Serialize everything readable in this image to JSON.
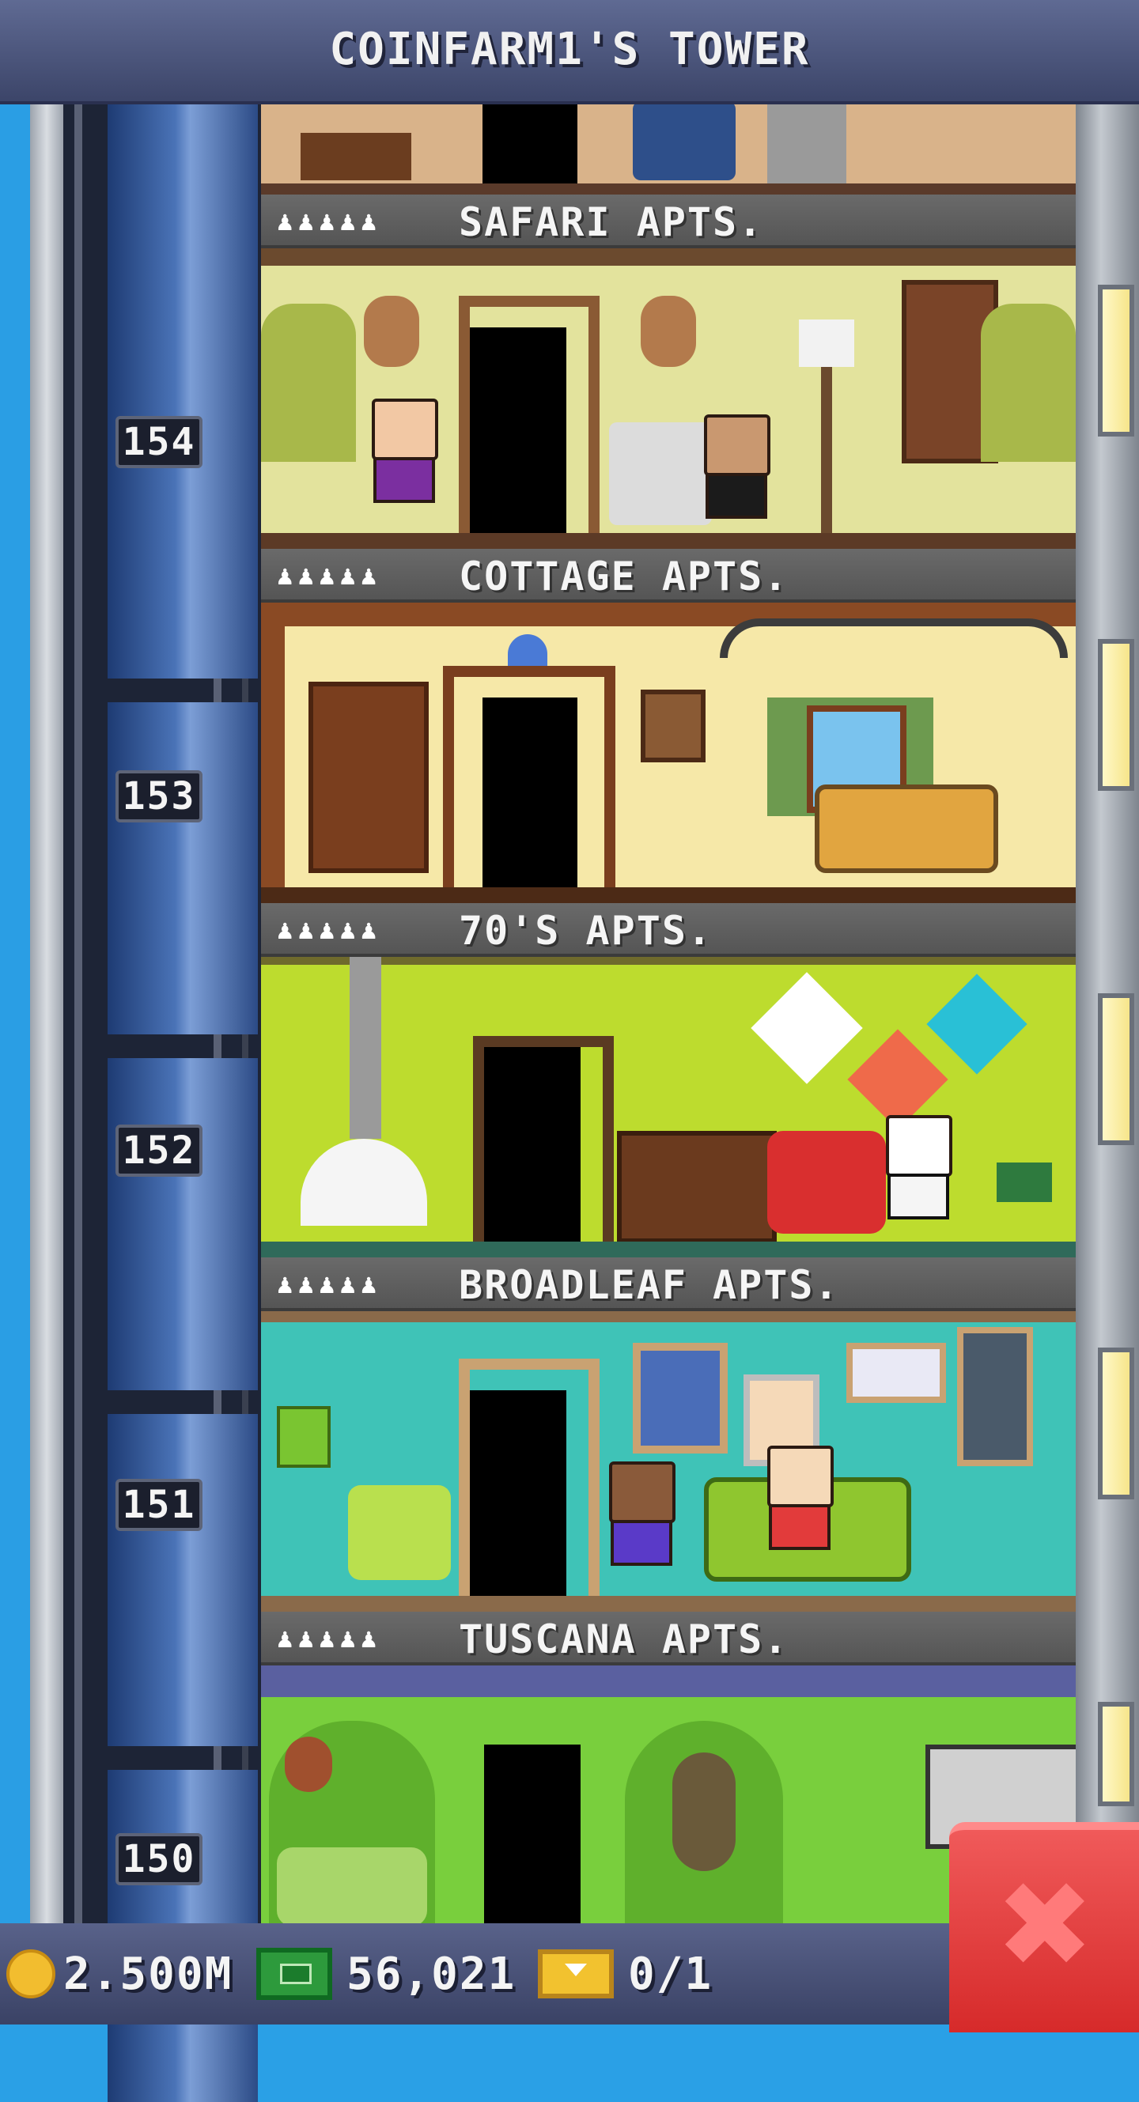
{
  "header": {
    "title": "COINFARM1'S TOWER"
  },
  "floors": [
    {
      "number": "154",
      "name": "SAFARI APTS.",
      "residents_icon": "♟♟♟♟♟"
    },
    {
      "number": "153",
      "name": "COTTAGE APTS.",
      "residents_icon": "♟♟♟♟♟"
    },
    {
      "number": "152",
      "name": "70'S APTS.",
      "residents_icon": "♟♟♟♟♟"
    },
    {
      "number": "151",
      "name": "BROADLEAF APTS.",
      "residents_icon": "♟♟♟♟♟"
    },
    {
      "number": "150",
      "name": "TUSCANA APTS.",
      "residents_icon": "♟♟♟♟♟"
    }
  ],
  "footer": {
    "coins": "2.500M",
    "bux": "56,021",
    "tickets": "0/1"
  },
  "close_button": {
    "label": "✖"
  },
  "colors": {
    "safari_wall": "#e3e39d",
    "cottage_wall": "#f6e8a8",
    "seventies_wall": "#bddc2e",
    "broadleaf_wall": "#3fc3b7",
    "tuscana_wall": "#79cf3d",
    "close_red": "#e23b3b"
  },
  "icons": {
    "coin": "coin-icon",
    "bux": "bux-icon",
    "ticket": "ticket-icon",
    "close": "close-icon"
  }
}
